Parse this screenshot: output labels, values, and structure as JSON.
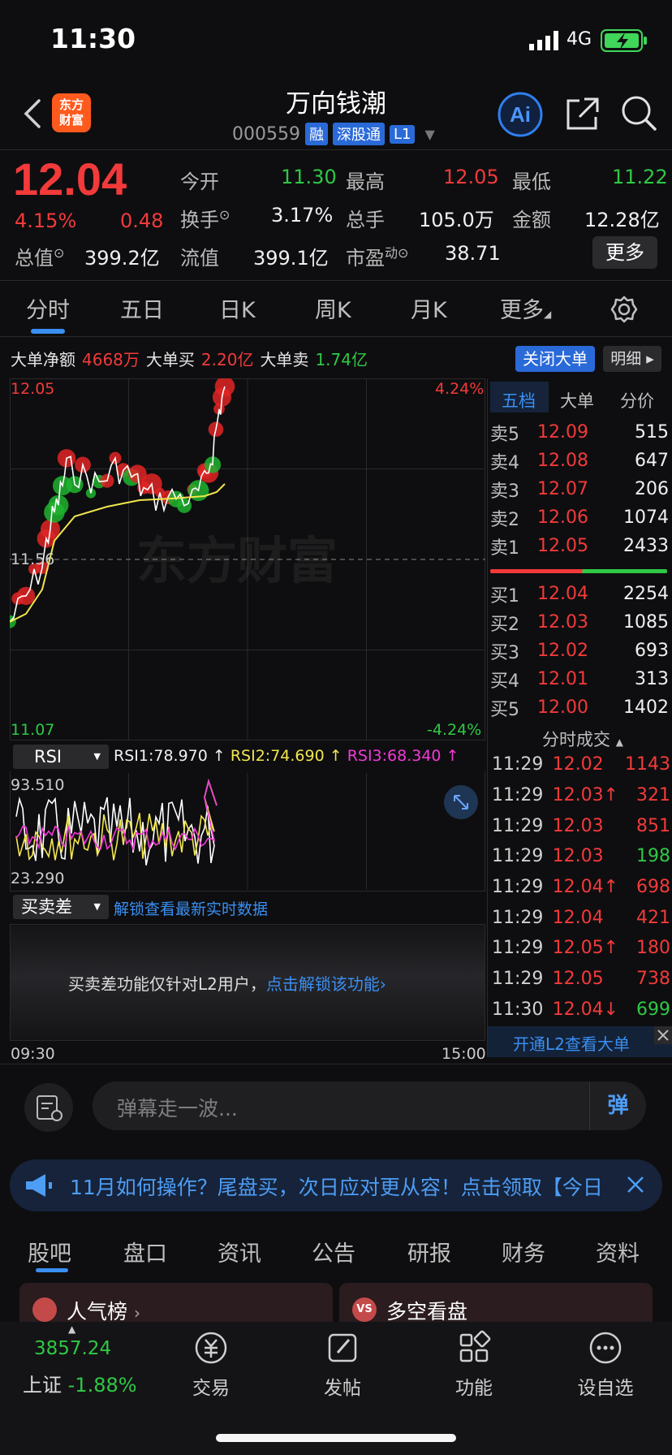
{
  "status": {
    "time": "11:30",
    "network": "4G"
  },
  "header": {
    "title": "万向钱潮",
    "code": "000559",
    "tags": [
      "融",
      "深股通",
      "L1"
    ],
    "logo_line1": "东方",
    "logo_line2": "财富"
  },
  "quote": {
    "price": "12.04",
    "change_pct": "4.15%",
    "change": "0.48",
    "open_label": "今开",
    "open": "11.30",
    "high_label": "最高",
    "high": "12.05",
    "low_label": "最低",
    "low": "11.22",
    "turnover_label": "换手",
    "turnover": "3.17%",
    "volume_label": "总手",
    "volume": "105.0万",
    "amount_label": "金额",
    "amount": "12.28亿",
    "mktcap_label": "总值",
    "mktcap": "399.2亿",
    "float_label": "流值",
    "float": "399.1亿",
    "pe_label": "市盈",
    "pe_sup": "动",
    "pe": "38.71",
    "more": "更多"
  },
  "tabs": [
    "分时",
    "五日",
    "日K",
    "周K",
    "月K",
    "更多"
  ],
  "big_order": {
    "net_label": "大单净额",
    "net": "4668万",
    "buy_label": "大单买",
    "buy": "2.20亿",
    "sell_label": "大单卖",
    "sell": "1.74亿",
    "close_btn": "关闭大单",
    "detail_btn": "明细"
  },
  "chart_labels": {
    "top_price": "12.05",
    "top_pct": "4.24%",
    "mid_price": "11.56",
    "bottom_price": "11.07",
    "bottom_pct": "-4.24%",
    "watermark": "东方财富",
    "time_start": "09:30",
    "time_end": "15:00"
  },
  "rsi": {
    "selector": "RSI",
    "rsi1": "RSI1:78.970 ↑",
    "rsi2": "RSI2:74.690 ↑",
    "rsi3": "RSI3:68.340 ↑",
    "max": "93.510",
    "min": "23.290"
  },
  "spread": {
    "selector": "买卖差",
    "unlock_link": "解锁查看最新实时数据",
    "msg": "买卖差功能仅针对L2用户，",
    "msg_link": "点击解锁该功能›"
  },
  "orderbook": {
    "tabs": [
      "五档",
      "大单",
      "分价"
    ],
    "asks": [
      {
        "label": "卖5",
        "price": "12.09",
        "vol": "515"
      },
      {
        "label": "卖4",
        "price": "12.08",
        "vol": "647"
      },
      {
        "label": "卖3",
        "price": "12.07",
        "vol": "206"
      },
      {
        "label": "卖2",
        "price": "12.06",
        "vol": "1074"
      },
      {
        "label": "卖1",
        "price": "12.05",
        "vol": "2433"
      }
    ],
    "bids": [
      {
        "label": "买1",
        "price": "12.04",
        "vol": "2254"
      },
      {
        "label": "买2",
        "price": "12.03",
        "vol": "1085"
      },
      {
        "label": "买3",
        "price": "12.02",
        "vol": "693"
      },
      {
        "label": "买4",
        "price": "12.01",
        "vol": "313"
      },
      {
        "label": "买5",
        "price": "12.00",
        "vol": "1402"
      }
    ],
    "trades_title": "分时成交",
    "trades": [
      {
        "time": "11:29",
        "price": "12.02",
        "vol": "1143",
        "dir": ""
      },
      {
        "time": "11:29",
        "price": "12.03",
        "vol": "321",
        "dir": "↑"
      },
      {
        "time": "11:29",
        "price": "12.03",
        "vol": "851",
        "dir": ""
      },
      {
        "time": "11:29",
        "price": "12.03",
        "vol": "198",
        "dir": ""
      },
      {
        "time": "11:29",
        "price": "12.04",
        "vol": "698",
        "dir": "↑"
      },
      {
        "time": "11:29",
        "price": "12.04",
        "vol": "421",
        "dir": ""
      },
      {
        "time": "11:29",
        "price": "12.05",
        "vol": "180",
        "dir": "↑"
      },
      {
        "time": "11:29",
        "price": "12.05",
        "vol": "738",
        "dir": ""
      },
      {
        "time": "11:30",
        "price": "12.04",
        "vol": "699",
        "dir": "↓"
      }
    ],
    "l2_link": "开通L2查看大单"
  },
  "danmu": {
    "placeholder": "弹幕走一波...",
    "send": "弹"
  },
  "notice": {
    "text": "11月如何操作？尾盘买，次日应对更从容！点击领取【今日"
  },
  "bottom_tabs": [
    "股吧",
    "盘口",
    "资讯",
    "公告",
    "研报",
    "财务",
    "资料"
  ],
  "cards": {
    "left": "人气榜",
    "right": "多空看盘"
  },
  "bottom_bar": {
    "index_value": "3857.24",
    "index_name": "上证",
    "index_change": "-1.88%",
    "items": [
      "交易",
      "发帖",
      "功能",
      "设自选"
    ]
  },
  "colors": {
    "up": "#f23a3a",
    "down": "#2fc845",
    "accent": "#3a8ff2"
  }
}
